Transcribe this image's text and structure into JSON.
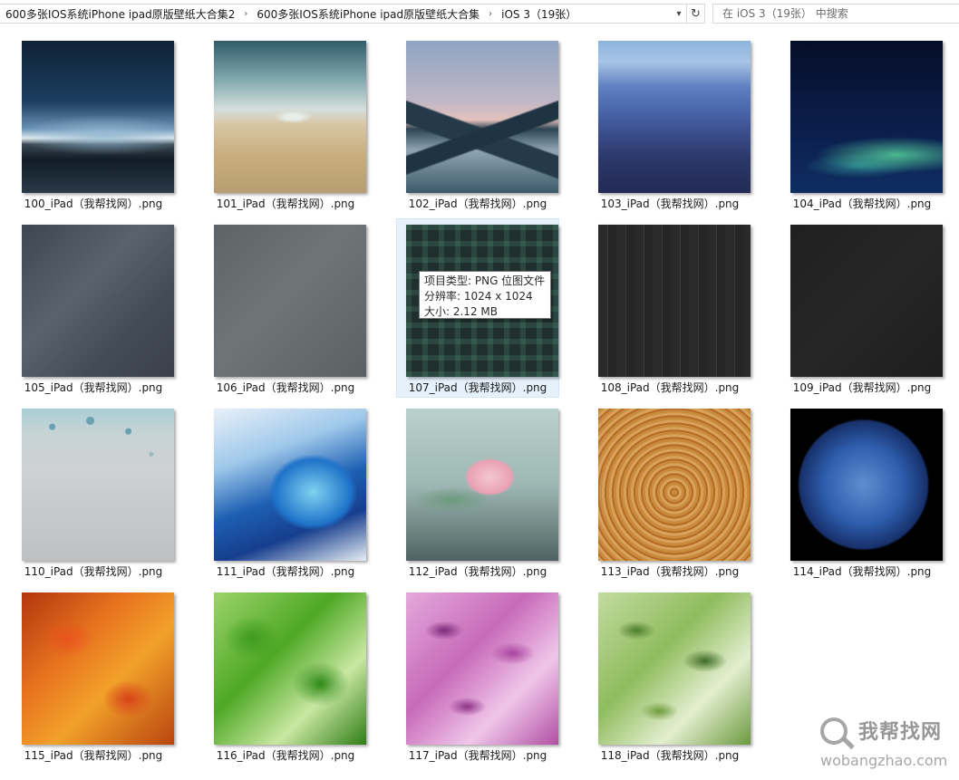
{
  "address_bar": {
    "breadcrumbs": [
      "600多张IOS系统iPhone ipad原版壁纸大合集2",
      "600多张IOS系统iPhone ipad原版壁纸大合集",
      "iOS 3（19张）"
    ],
    "separator": "›",
    "dropdown_icon": "▾",
    "refresh_icon": "↻"
  },
  "search": {
    "placeholder": "在 iOS 3（19张） 中搜索",
    "icon": "search-icon"
  },
  "files": [
    {
      "name": "100_iPad（我帮找网）.png",
      "selected": false
    },
    {
      "name": "101_iPad（我帮找网）.png",
      "selected": false
    },
    {
      "name": "102_iPad（我帮找网）.png",
      "selected": false
    },
    {
      "name": "103_iPad（我帮找网）.png",
      "selected": false
    },
    {
      "name": "104_iPad（我帮找网）.png",
      "selected": false
    },
    {
      "name": "105_iPad（我帮找网）.png",
      "selected": false
    },
    {
      "name": "106_iPad（我帮找网）.png",
      "selected": false
    },
    {
      "name": "107_iPad（我帮找网）.png",
      "selected": true
    },
    {
      "name": "108_iPad（我帮找网）.png",
      "selected": false
    },
    {
      "name": "109_iPad（我帮找网）.png",
      "selected": false
    },
    {
      "name": "110_iPad（我帮找网）.png",
      "selected": false
    },
    {
      "name": "111_iPad（我帮找网）.png",
      "selected": false
    },
    {
      "name": "112_iPad（我帮找网）.png",
      "selected": false
    },
    {
      "name": "113_iPad（我帮找网）.png",
      "selected": false
    },
    {
      "name": "114_iPad（我帮找网）.png",
      "selected": false
    },
    {
      "name": "115_iPad（我帮找网）.png",
      "selected": false
    },
    {
      "name": "116_iPad（我帮找网）.png",
      "selected": false
    },
    {
      "name": "117_iPad（我帮找网）.png",
      "selected": false
    },
    {
      "name": "118_iPad（我帮找网）.png",
      "selected": false
    }
  ],
  "tooltip": {
    "type_line": "项目类型: PNG 位图文件",
    "resolution_line": "分辨率: 1024 x 1024",
    "size_line": "大小: 2.12 MB"
  },
  "watermark": {
    "text_cn": "我帮找网",
    "url": "wobangzhao.com"
  }
}
